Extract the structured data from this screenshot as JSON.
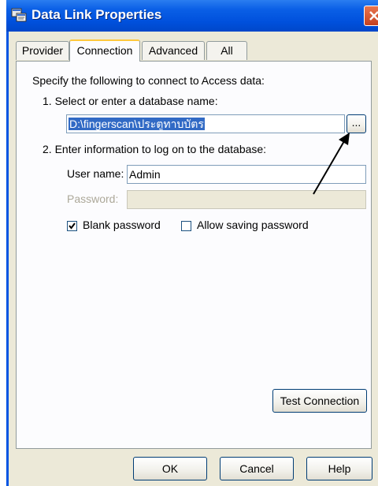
{
  "window": {
    "title": "Data Link Properties",
    "icon": "data-link-icon",
    "close_icon": "close-icon"
  },
  "tabs": [
    {
      "label": "Provider",
      "active": false
    },
    {
      "label": "Connection",
      "active": true
    },
    {
      "label": "Advanced",
      "active": false
    },
    {
      "label": "All",
      "active": false
    }
  ],
  "connection": {
    "intro": "Specify the following to connect to Access data:",
    "step1_label": "1. Select or enter a database name:",
    "database_path": "D:\\fingerscan\\ประตูทาบบัตร",
    "browse_label": "...",
    "step2_label": "2. Enter information to log on to the database:",
    "username_label": "User name:",
    "username_value": "Admin",
    "password_label": "Password:",
    "password_value": "",
    "blank_password_label": "Blank password",
    "blank_password_checked": true,
    "allow_saving_label": "Allow saving password",
    "allow_saving_checked": false,
    "test_connection_label": "Test Connection"
  },
  "footer": {
    "ok_label": "OK",
    "cancel_label": "Cancel",
    "help_label": "Help"
  },
  "colors": {
    "title_bar": "#0054e3",
    "dialog_bg": "#ece9d8",
    "selection": "#316ac5",
    "close_button": "#d54e28"
  }
}
